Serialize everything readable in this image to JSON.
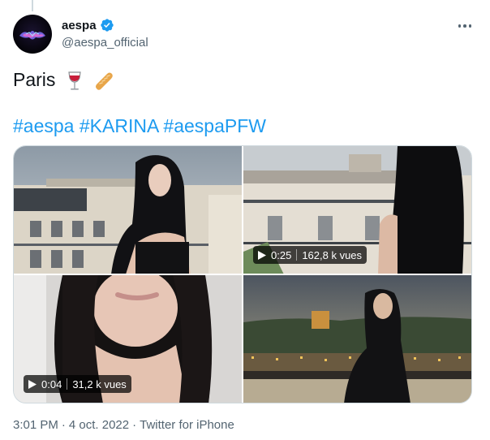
{
  "tweet": {
    "display_name": "aespa",
    "handle": "@aespa_official",
    "text": "Paris",
    "emojis": [
      "wine-glass-emoji",
      "baguette-emoji"
    ],
    "hashtags": [
      "#aespa",
      "#KARINA",
      "#aespaPFW"
    ],
    "media": [
      {
        "kind": "photo",
        "icon": "photo-rooftop-portrait"
      },
      {
        "kind": "video",
        "duration": "0:25",
        "views": "162,8 k vues"
      },
      {
        "kind": "video",
        "duration": "0:04",
        "views": "31,2 k vues"
      },
      {
        "kind": "photo",
        "icon": "photo-eiffel-dusk"
      }
    ],
    "time": "3:01 PM",
    "date": "4 oct. 2022",
    "separator": "·",
    "source": "Twitter for iPhone"
  },
  "colors": {
    "link": "#1d9bf0",
    "text": "#0f1419",
    "muted": "#536471",
    "border": "#cfd9de"
  }
}
